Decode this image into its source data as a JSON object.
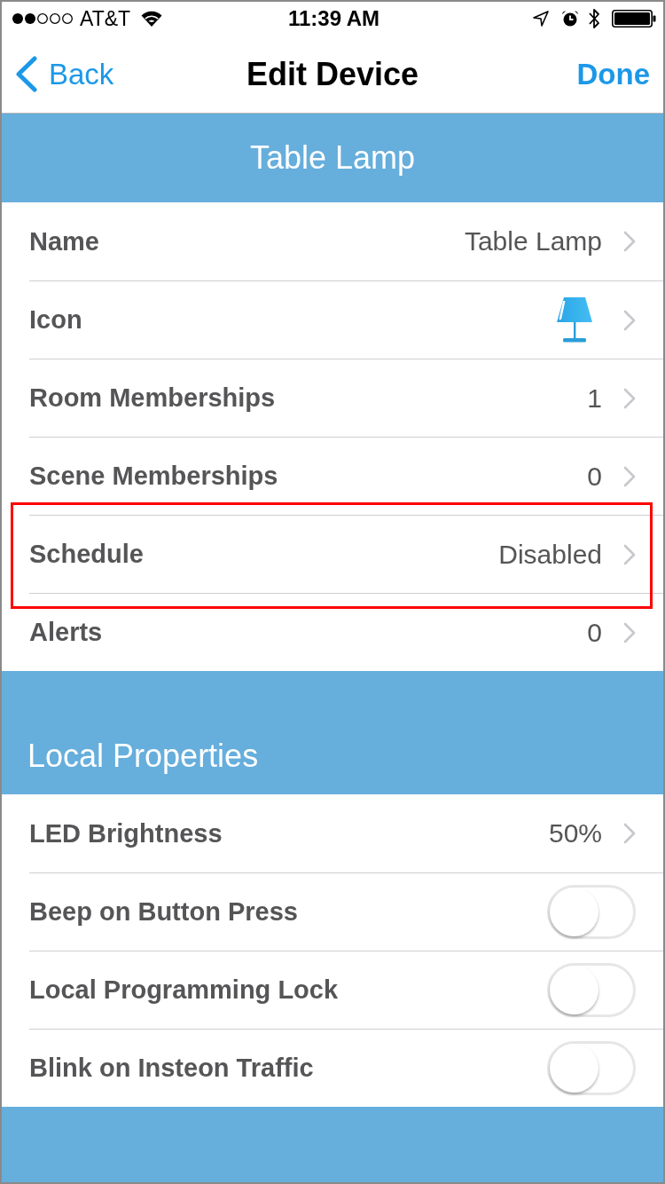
{
  "status_bar": {
    "carrier": "AT&T",
    "time": "11:39 AM"
  },
  "nav_bar": {
    "back": "Back",
    "title": "Edit Device",
    "done": "Done"
  },
  "header": {
    "title": "Table Lamp"
  },
  "rows": [
    {
      "kind": "value",
      "label": "Name",
      "value": "Table Lamp",
      "highlighted": false
    },
    {
      "kind": "icon",
      "label": "Icon",
      "highlighted": false
    },
    {
      "kind": "value",
      "label": "Room Memberships",
      "value": "1",
      "highlighted": false
    },
    {
      "kind": "value",
      "label": "Scene Memberships",
      "value": "0",
      "highlighted": false
    },
    {
      "kind": "value",
      "label": "Schedule",
      "value": "Disabled",
      "highlighted": true
    },
    {
      "kind": "value",
      "label": "Alerts",
      "value": "0",
      "highlighted": false
    }
  ],
  "local_properties": {
    "title": "Local Properties",
    "rows": [
      {
        "kind": "value",
        "label": "LED Brightness",
        "value": "50%"
      },
      {
        "kind": "toggle",
        "label": "Beep on Button Press",
        "on": false
      },
      {
        "kind": "toggle",
        "label": "Local Programming Lock",
        "on": false
      },
      {
        "kind": "toggle",
        "label": "Blink on Insteon Traffic",
        "on": false
      }
    ]
  }
}
